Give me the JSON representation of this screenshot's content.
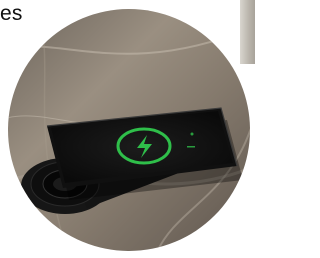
{
  "caption": {
    "text": "es"
  },
  "photo": {
    "subject": "wireless-charging-pad-with-phone",
    "accent_color": "#2fbf4a",
    "surface_color": "#8c7f70"
  }
}
